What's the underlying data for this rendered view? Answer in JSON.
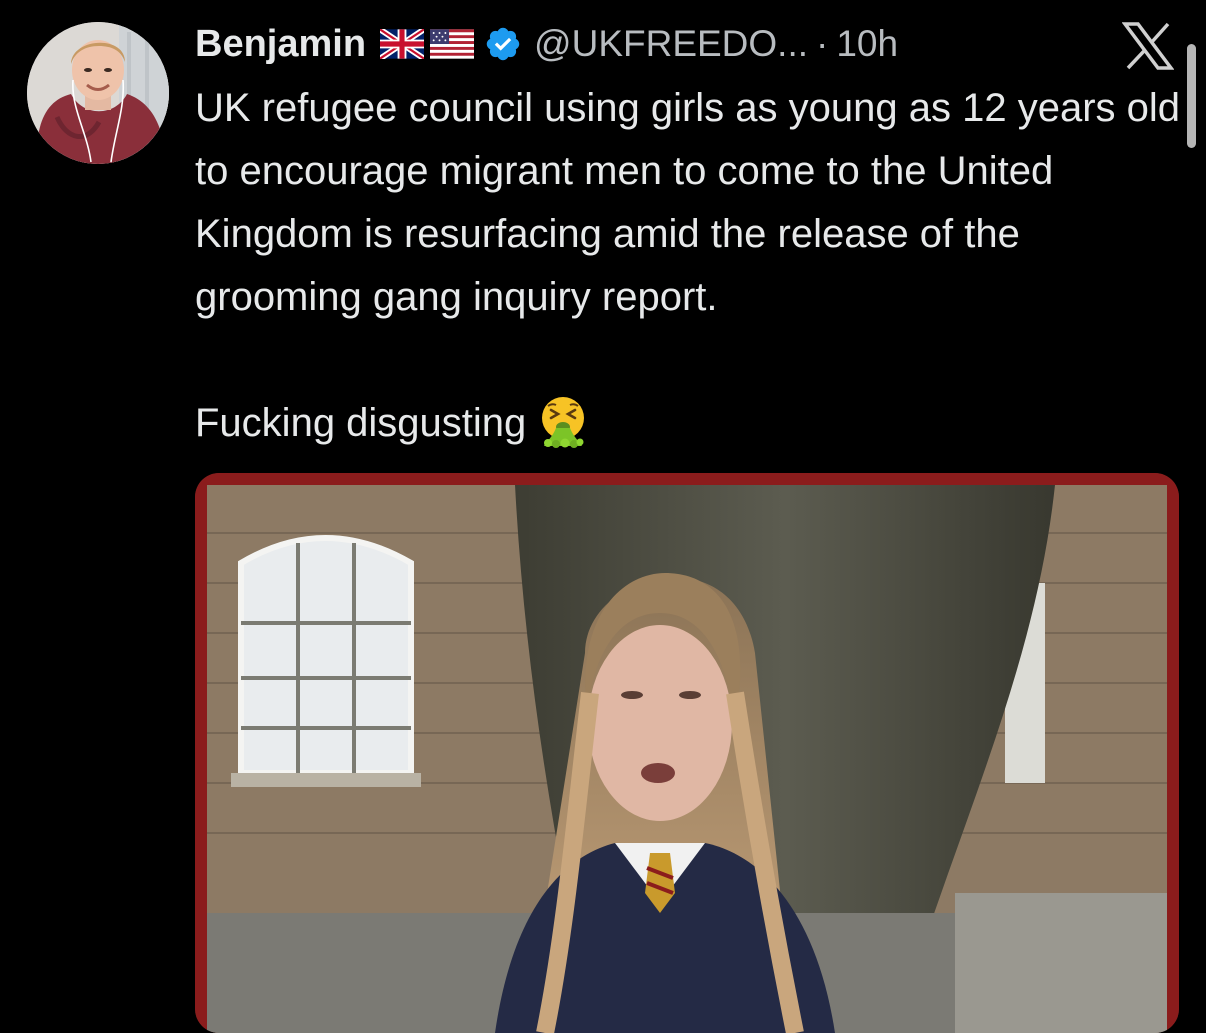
{
  "tweet": {
    "author_name": "Benjamin",
    "handle": "@UKFREEDO...",
    "separator": "·",
    "time": "10h",
    "text_paragraphs": [
      "UK refugee council using girls as young as 12 years old to encourage migrant men to come to the United Kingdom is resurfacing amid the release of the grooming gang inquiry report.",
      "Fucking disgusting"
    ],
    "author_flags": [
      "uk-flag-icon",
      "us-flag-icon"
    ],
    "verified_icon": "verified-badge-icon",
    "emoji": "vomiting-face-emoji"
  },
  "app": {
    "logo": "x-logo-icon"
  },
  "colors": {
    "background": "#000000",
    "text": "#e7e9ea",
    "secondary_text": "#b8bcc0",
    "verified_blue": "#1d9bf0",
    "media_border": "#8b1c1c"
  }
}
